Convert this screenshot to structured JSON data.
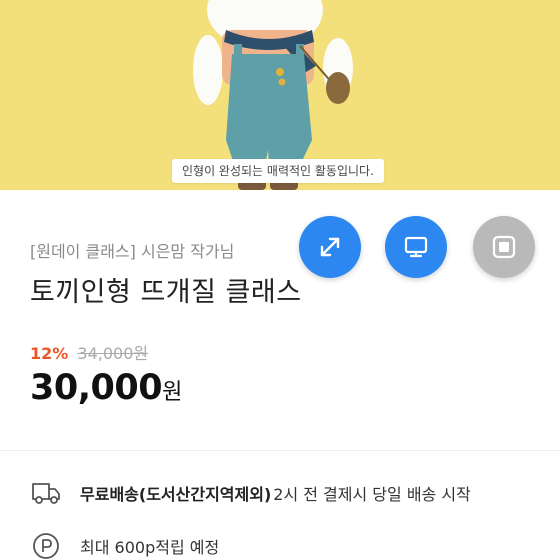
{
  "hero": {
    "caption": "인형이 완성되는 매력적인 활동입니다.",
    "background_color": "#f4e07a"
  },
  "fabs": {
    "expand_icon": "expand-arrows-icon",
    "screen_icon": "monitor-icon",
    "stop_icon": "stop-square-icon",
    "blue": "#2d87f0",
    "gray": "#b9b9b9"
  },
  "product": {
    "breadcrumb": "[원데이 클래스] 시은맘 작가님",
    "title": "토끼인형 뜨개질 클래스",
    "discount_rate": "12%",
    "original_price": "34,000원",
    "price_value": "30,000",
    "price_unit": "원"
  },
  "shipping": {
    "icon": "delivery-truck-icon",
    "strong": "무료배송(도서산간지역제외)",
    "detail": "2시 전 결제시 당일 배송 시작"
  },
  "points": {
    "icon": "point-p-icon",
    "text": "최대 600p적립 예정"
  },
  "colors": {
    "discount": "#e8562a",
    "muted": "#8a8a8a"
  }
}
